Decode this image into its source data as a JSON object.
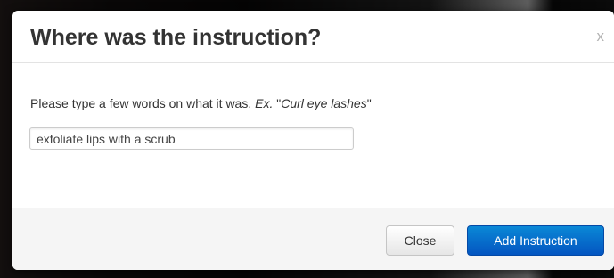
{
  "dialog": {
    "title": "Where was the instruction?",
    "close_glyph": "x",
    "prompt_text": "Please type a few words on what it was. ",
    "prompt_example_prefix": "Ex.",
    "prompt_example_open_quote": " \"",
    "prompt_example_text": "Curl eye lashes",
    "prompt_example_close_quote": "\"",
    "input_value": "exfoliate lips with a scrub",
    "close_button_label": "Close",
    "submit_button_label": "Add Instruction"
  },
  "colors": {
    "primary_button": "#0a6fd0",
    "title_text": "#333333",
    "footer_background": "#f5f5f5"
  },
  "icons": {
    "close": "close-icon"
  }
}
